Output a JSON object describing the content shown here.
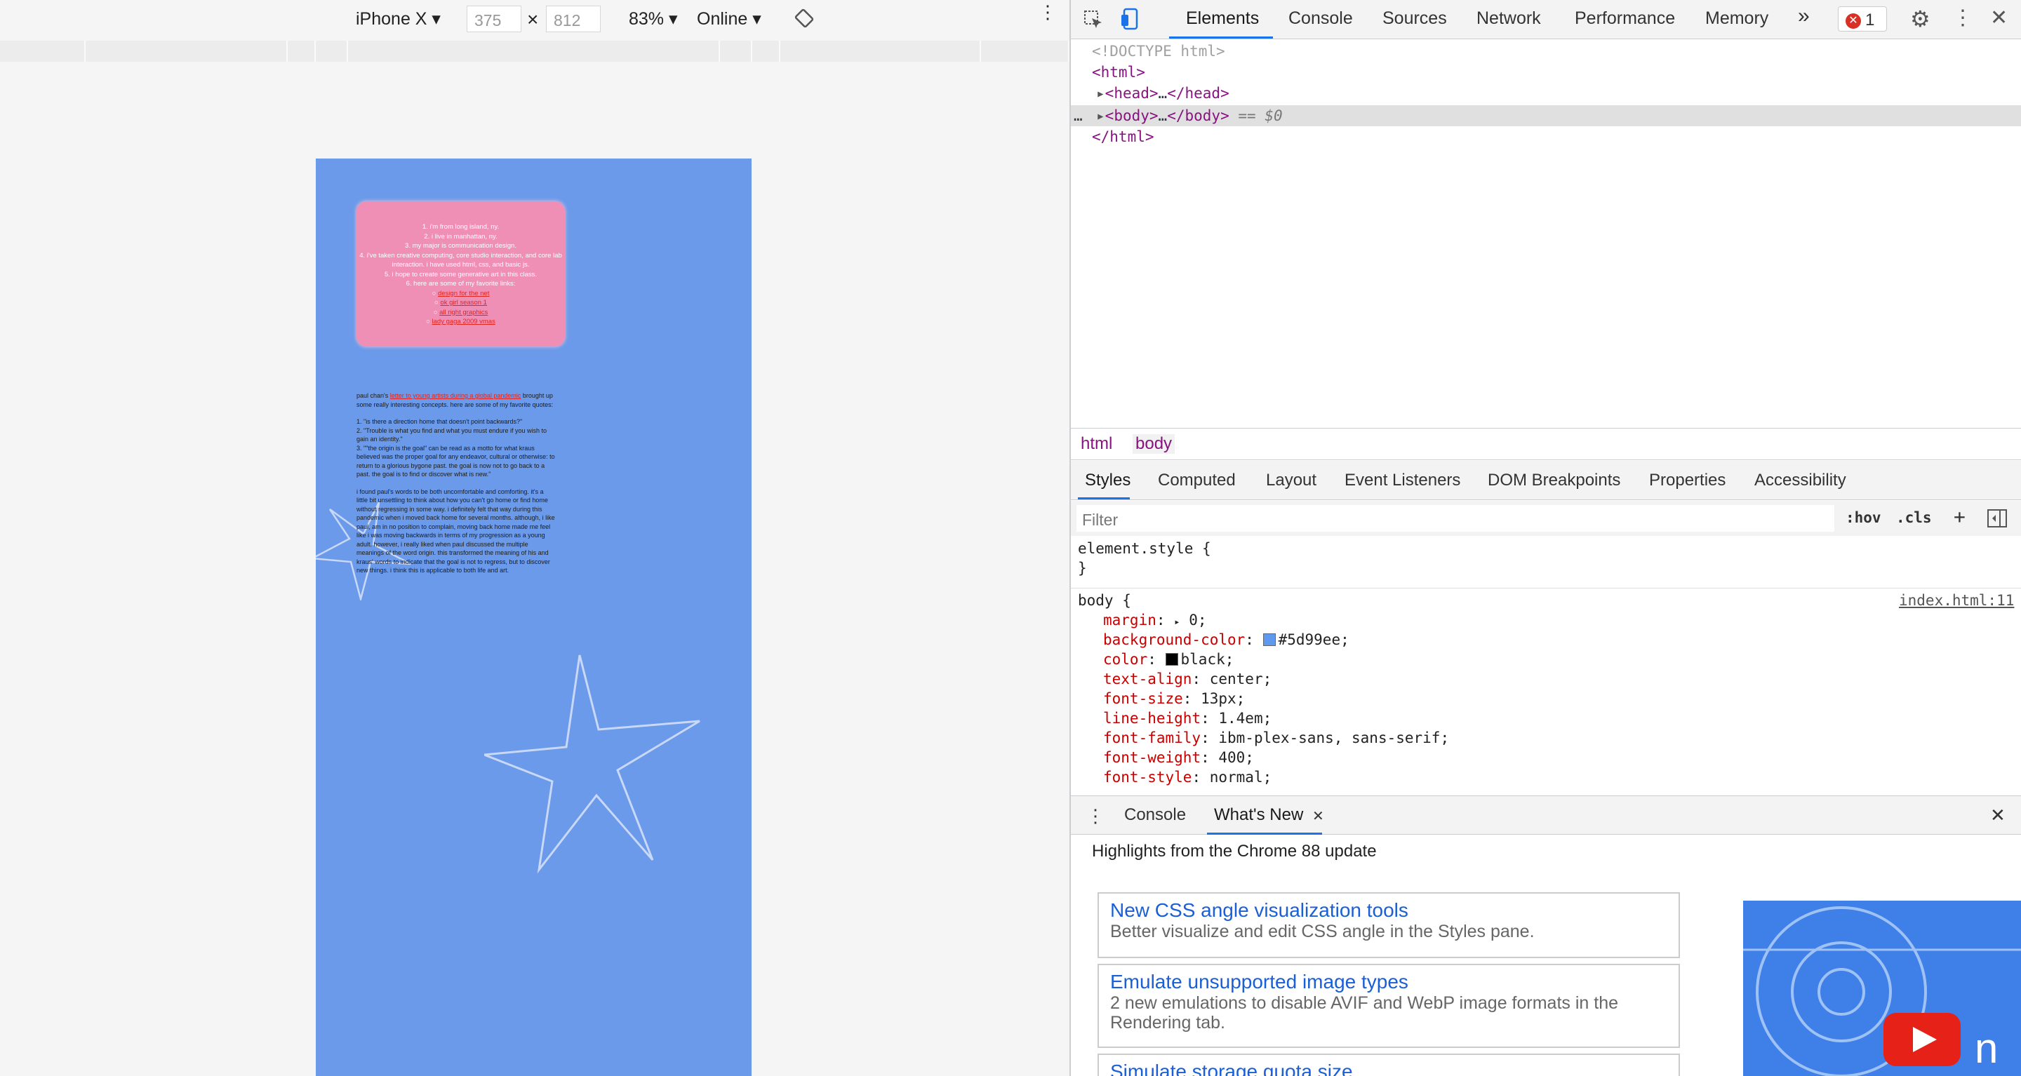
{
  "device_toolbar": {
    "device": "iPhone X",
    "width": "375",
    "height": "812",
    "times": "×",
    "zoom": "83%",
    "network": "Online"
  },
  "page": {
    "intro_items": [
      "1. i'm from long island, ny.",
      "2. i live in manhattan, ny.",
      "3. my major is communication design.",
      "4. i've taken creative computing, core studio interaction, and core lab interaction. i have used html, css, and basic js.",
      "5. i hope to create some generative art in this class.",
      "6. here are some of my favorite links:"
    ],
    "links": [
      "design for the net",
      "ok girl season 1",
      "all right graphics",
      "lady gaga 2009 vmas"
    ],
    "essay_prefix": "paul chan's ",
    "essay_link": "letter to young artists during a global pandemic",
    "essay_rest": " brought up some really interesting concepts. here are some of my favorite quotes:",
    "quotes": [
      "1. \"is there a direction home that doesn't point backwards?\"",
      "2. \"Trouble is what you find and what you must endure if you wish to gain an identity.\"",
      "3. \"\"the origin is the goal\" can be read as a motto for what kraus believed was the proper goal for any endeavor, cultural or otherwise: to return to a glorious bygone past. the goal is now not to go back to a past. the goal is to find or discover what is new.\""
    ],
    "reflection": "i found paul's words to be both uncomfortable and comforting. it's a little bit unsettling to think about how you can't go home or find home without regressing in some way. i definitely felt that way during this pandemic when i moved back home for several months. although, i like paul, am in no position to complain, moving back home made me feel like i was moving backwards in terms of my progression as a young adult. however, i really liked when paul discussed the multiple meanings of the word origin. this transformed the meaning of his and kraus' words to indicate that the goal is not to regress, but to discover new things. i think this is applicable to both life and art."
  },
  "devtools": {
    "tabs": [
      "Elements",
      "Console",
      "Sources",
      "Network",
      "Performance",
      "Memory"
    ],
    "more": "»",
    "error_count": "1",
    "dom": {
      "doctype": "<!DOCTYPE html>",
      "html_open": "<html>",
      "head": "head",
      "body": "body",
      "ellipsis": "…",
      "selected_marker": "== $0",
      "html_close": "</html>",
      "row_dots": "…"
    },
    "breadcrumbs": [
      "html",
      "body"
    ],
    "style_tabs": [
      "Styles",
      "Computed",
      "Layout",
      "Event Listeners",
      "DOM Breakpoints",
      "Properties",
      "Accessibility"
    ],
    "filter_placeholder": "Filter",
    "hov": ":hov",
    "cls": ".cls",
    "plus": "+",
    "element_style": "element.style {",
    "close_brace": "}",
    "body_selector": "body {",
    "source_link": "index.html:11",
    "declarations": [
      {
        "prop": "margin",
        "value": "0;"
      },
      {
        "prop": "background-color",
        "value": "#5d99ee;"
      },
      {
        "prop": "color",
        "value": "black;"
      },
      {
        "prop": "text-align",
        "value": "center;"
      },
      {
        "prop": "font-size",
        "value": "13px;"
      },
      {
        "prop": "line-height",
        "value": "1.4em;"
      },
      {
        "prop": "font-family",
        "value": "ibm-plex-sans, sans-serif;"
      },
      {
        "prop": "font-weight",
        "value": "400;"
      },
      {
        "prop": "font-style",
        "value": "normal;"
      }
    ],
    "swatches": {
      "background": "#5d99ee",
      "color": "#000000"
    },
    "drawer_tabs": [
      "Console",
      "What's New"
    ],
    "highlights": "Highlights from the Chrome 88 update",
    "cards": [
      {
        "title": "New CSS angle visualization tools",
        "desc": "Better visualize and edit CSS angle in the Styles pane."
      },
      {
        "title": "Emulate unsupported image types",
        "desc": "2 new emulations to disable AVIF and WebP image formats in the Rendering tab."
      },
      {
        "title": "Simulate storage quota size",
        "desc": ""
      }
    ],
    "thumb_text": "n"
  },
  "colors": {
    "page_bg": "#6a9ae9",
    "pink_box": "#f08fb5",
    "link": "#e0261f",
    "accent": "#1a73e8"
  }
}
